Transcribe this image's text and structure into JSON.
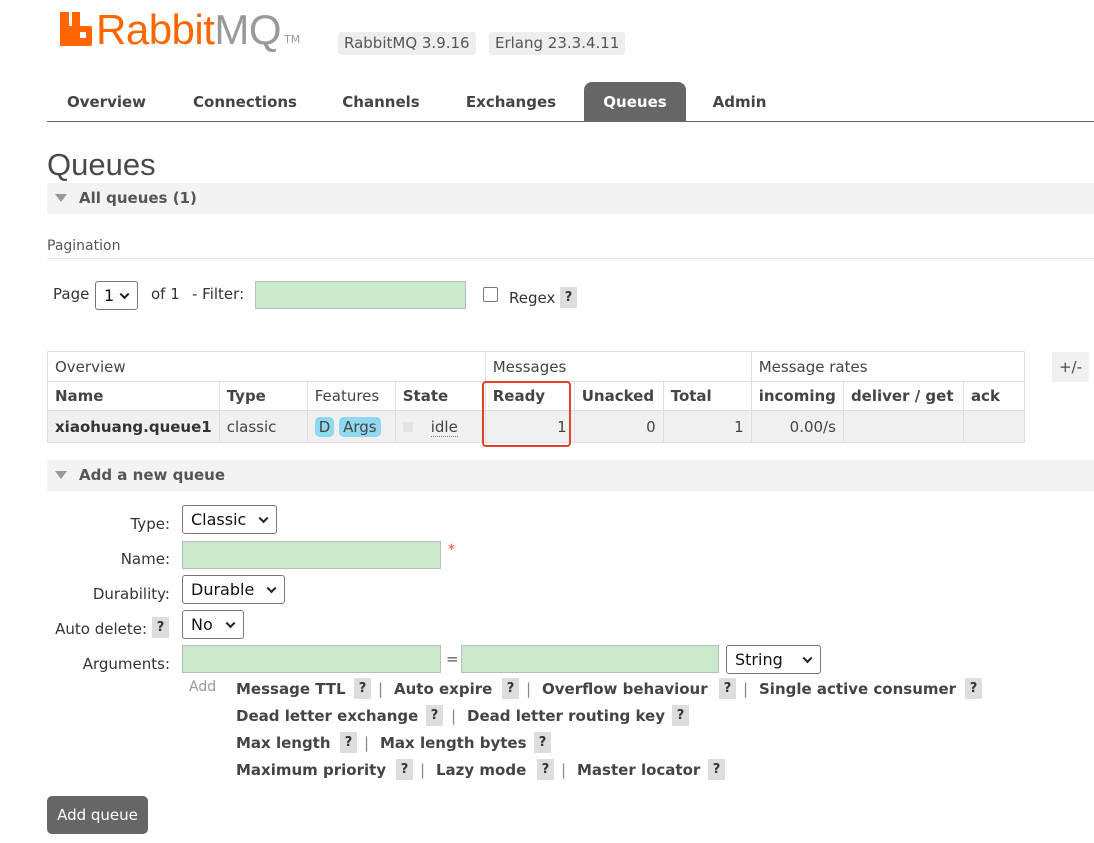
{
  "header": {
    "logo_text_a": "Rabbit",
    "logo_text_b": "MQ",
    "logo_tm": "TM",
    "rabbitmq_version": "RabbitMQ 3.9.16",
    "erlang_version": "Erlang 23.3.4.11"
  },
  "tabs": [
    {
      "label": "Overview"
    },
    {
      "label": "Connections"
    },
    {
      "label": "Channels"
    },
    {
      "label": "Exchanges"
    },
    {
      "label": "Queues",
      "active": true
    },
    {
      "label": "Admin"
    }
  ],
  "page_title": "Queues",
  "all_queues": {
    "title": "All queues (1)"
  },
  "pagination": {
    "label": "Pagination",
    "page_label": "Page",
    "page_value": "1",
    "of_label": "of 1",
    "filter_label": "- Filter:",
    "filter_value": "",
    "regex_label": "Regex",
    "regex_checked": false,
    "help": "?"
  },
  "table": {
    "group_overview": "Overview",
    "group_messages": "Messages",
    "group_rates": "Message rates",
    "plus_minus": "+/-",
    "columns": {
      "name": "Name",
      "type": "Type",
      "features": "Features",
      "state": "State",
      "ready": "Ready",
      "unacked": "Unacked",
      "total": "Total",
      "incoming": "incoming",
      "deliver_get": "deliver / get",
      "ack": "ack"
    },
    "rows": [
      {
        "name": "xiaohuang.queue1",
        "type": "classic",
        "feature_d": "D",
        "feature_args": "Args",
        "state": "idle",
        "ready": "1",
        "unacked": "0",
        "total": "1",
        "incoming": "0.00/s",
        "deliver_get": "",
        "ack": ""
      }
    ]
  },
  "add_queue": {
    "title": "Add a new queue",
    "type_label": "Type:",
    "type_value": "Classic",
    "name_label": "Name:",
    "name_value": "",
    "required_mark": "*",
    "durability_label": "Durability:",
    "durability_value": "Durable",
    "auto_delete_label": "Auto delete:",
    "auto_delete_value": "No",
    "arguments_label": "Arguments:",
    "arg_key": "",
    "equals": "=",
    "arg_value": "",
    "arg_type": "String",
    "add_label": "Add",
    "arg_links": {
      "message_ttl": "Message TTL",
      "auto_expire": "Auto expire",
      "overflow": "Overflow behaviour",
      "single_active": "Single active consumer",
      "dl_exchange": "Dead letter exchange",
      "dl_routing_key": "Dead letter routing key",
      "max_length": "Max length",
      "max_length_bytes": "Max length bytes",
      "max_priority": "Maximum priority",
      "lazy_mode": "Lazy mode",
      "master_locator": "Master locator"
    },
    "separator": "|",
    "help": "?",
    "button": "Add queue"
  },
  "colors": {
    "brand_orange": "#ff6600",
    "tab_active_bg": "#666666",
    "input_green": "#c9e8cc",
    "badge_blue": "#8ed8f0",
    "highlight_red": "#e2402a"
  }
}
